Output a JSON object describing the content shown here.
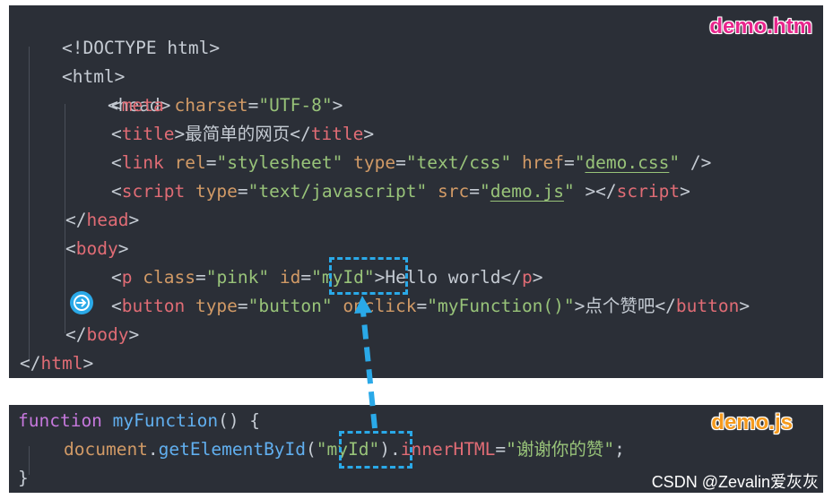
{
  "files": {
    "html_name": "demo.htm",
    "js_name": "demo.js"
  },
  "html_code": {
    "doctype": "<!DOCTYPE html>",
    "html_open": "<html>",
    "head_open": "<head>",
    "meta": {
      "tag": "meta",
      "attr": "charset",
      "value": "\"UTF-8\""
    },
    "title": {
      "tag": "title",
      "text": "最简单的网页"
    },
    "link": {
      "tag": "link",
      "rel_attr": "rel",
      "rel_val": "\"stylesheet\"",
      "type_attr": "type",
      "type_val": "\"text/css\"",
      "href_attr": "href",
      "href_val": "demo.css"
    },
    "script": {
      "tag": "script",
      "type_attr": "type",
      "type_val": "\"text/javascript\"",
      "src_attr": "src",
      "src_val": "demo.js"
    },
    "head_close": "head",
    "body_open": "body",
    "p": {
      "tag": "p",
      "class_attr": "class",
      "class_val": "\"pink\"",
      "id_attr": "id",
      "id_val": "myId",
      "text": "Hello world"
    },
    "button": {
      "tag": "button",
      "type_attr": "type",
      "type_val": "\"button\"",
      "onclick_attr": "onclick",
      "onclick_val": "\"myFunction()\"",
      "text": "点个赞吧"
    },
    "body_close": "body",
    "html_close": "html"
  },
  "js_code": {
    "keyword": "function",
    "fn_name": "myFunction",
    "fn_sig": "() {",
    "obj": "document",
    "method": "getElementById",
    "arg": "myId",
    "prop": "innerHTML",
    "value": "\"谢谢你的赞\"",
    "close": "}"
  },
  "watermark": "CSDN @Zevalin爱灰灰",
  "colors": {
    "background": "#2b2f37",
    "tag": "#e06c75",
    "attribute": "#d19a66",
    "string": "#98c379",
    "keyword": "#c678dd",
    "function": "#61afef",
    "highlight": "#2aa9e8"
  },
  "icons": {
    "breakpoint": "arrow-right-circle-icon"
  }
}
